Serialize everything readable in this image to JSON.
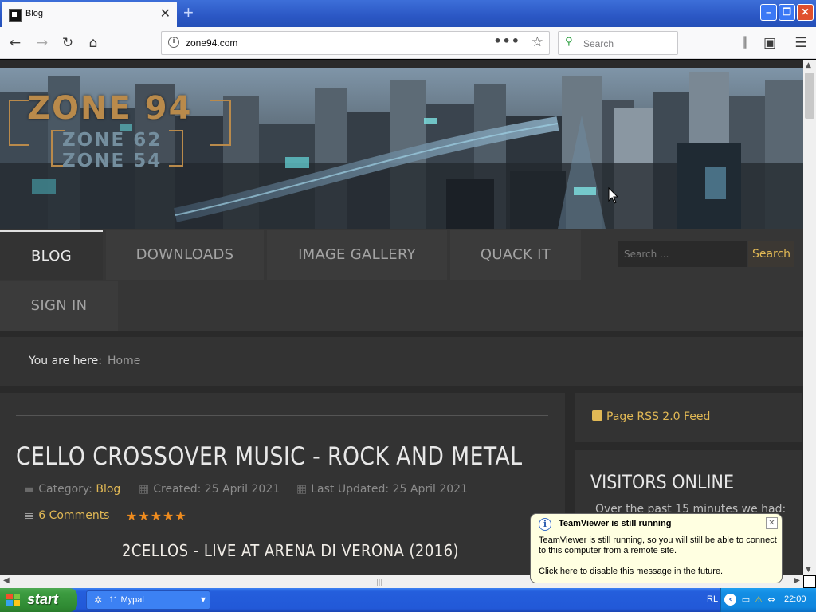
{
  "browser": {
    "tab_title": "Blog",
    "new_tab_symbol": "+",
    "url": "zone94.com",
    "search_placeholder": "Search",
    "page_actions_symbol": "•••"
  },
  "site": {
    "logo": {
      "main": "ZONE 94",
      "sub1": "ZONE 62",
      "sub2": "ZONE 54"
    },
    "nav": {
      "items": [
        "BLOG",
        "DOWNLOADS",
        "IMAGE GALLERY",
        "QUACK IT",
        "SIGN IN"
      ],
      "active": "BLOG"
    },
    "search": {
      "placeholder": "Search ...",
      "button": "Search"
    },
    "breadcrumb": {
      "label": "You are here:",
      "home": "Home"
    }
  },
  "article": {
    "title": "CELLO CROSSOVER MUSIC - ROCK AND METAL",
    "category_label": "Category:",
    "category": "Blog",
    "created": "Created: 25 April 2021",
    "updated": "Last Updated: 25 April 2021",
    "comments": "6 Comments",
    "rating_stars": 5,
    "rating_glyphs": "★★★★★",
    "subheading": "2CELLOS - LIVE AT ARENA DI VERONA (2016)"
  },
  "sidebar": {
    "rss": "Page RSS 2.0 Feed",
    "visitors_heading": "VISITORS ONLINE",
    "visitors_text": "Over the past 15 minutes we had:"
  },
  "balloon": {
    "title": "TeamViewer is still running",
    "text": "TeamViewer is still running, so you will still be able to connect to this computer from a remote site.",
    "link": "Click here to disable this message in the future."
  },
  "taskbar": {
    "start_label": "start",
    "task_label": "11 Mypal",
    "language": "RL",
    "clock": "22:00"
  },
  "colors": {
    "accent_gold": "#e2b955",
    "star_orange": "#f08c1e",
    "page_bg": "#2a2a2a",
    "panel_bg": "#333333",
    "xp_blue": "#245edc",
    "xp_green": "#3c9c40"
  }
}
